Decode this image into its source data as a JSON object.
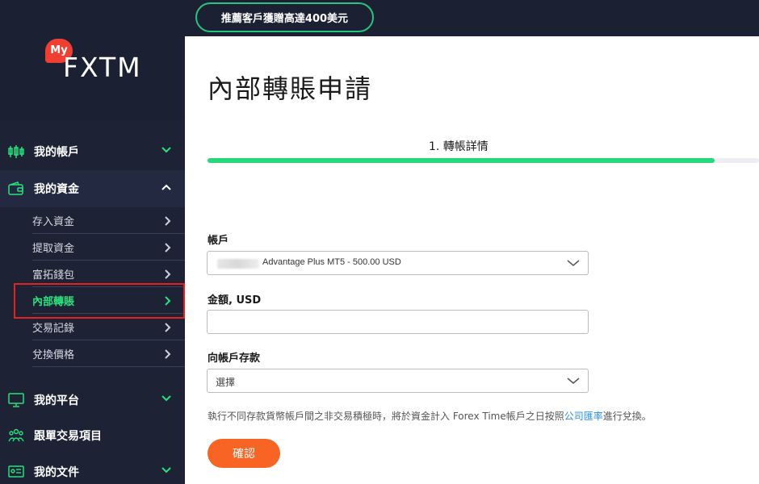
{
  "brand": {
    "logo_my": "My",
    "logo_name": "FXTM"
  },
  "topbar": {
    "promo_label": "推薦客戶獲贈高達400美元"
  },
  "sidebar": {
    "my_accounts": "我的帳戶",
    "my_funds": "我的資金",
    "sub_items": {
      "deposit": "存入資金",
      "withdraw": "提取資金",
      "wallet": "富拓錢包",
      "internal_transfer": "內部轉賬",
      "history": "交易記錄",
      "rates": "兌換價格"
    },
    "my_platforms": "我的平台",
    "copy_trading": "跟單交易項目",
    "my_documents": "我的文件"
  },
  "main": {
    "title": "內部轉賬申請",
    "step_label": "1. 轉帳詳情",
    "progress": 0.92,
    "account_label": "帳戶",
    "account_value": "Advantage Plus MT5 - 500.00 USD",
    "amount_label": "金額, USD",
    "amount_value": "",
    "deposit_to_label": "向帳戶存款",
    "deposit_to_placeholder": "選擇",
    "note_text": "執行不同存款貨幣帳戶間之非交易積極時，將於資金計入 Forex Time帳戶之日按照",
    "note_link": "公司匯率",
    "note_suffix": "進行兌換。",
    "confirm_label": "確認"
  },
  "colors": {
    "sidebar_bg": "#1d2235",
    "accent_green": "#26d77b",
    "confirm_orange": "#f86424",
    "highlight_red": "#e2231f",
    "link_blue": "#2a8de0"
  }
}
